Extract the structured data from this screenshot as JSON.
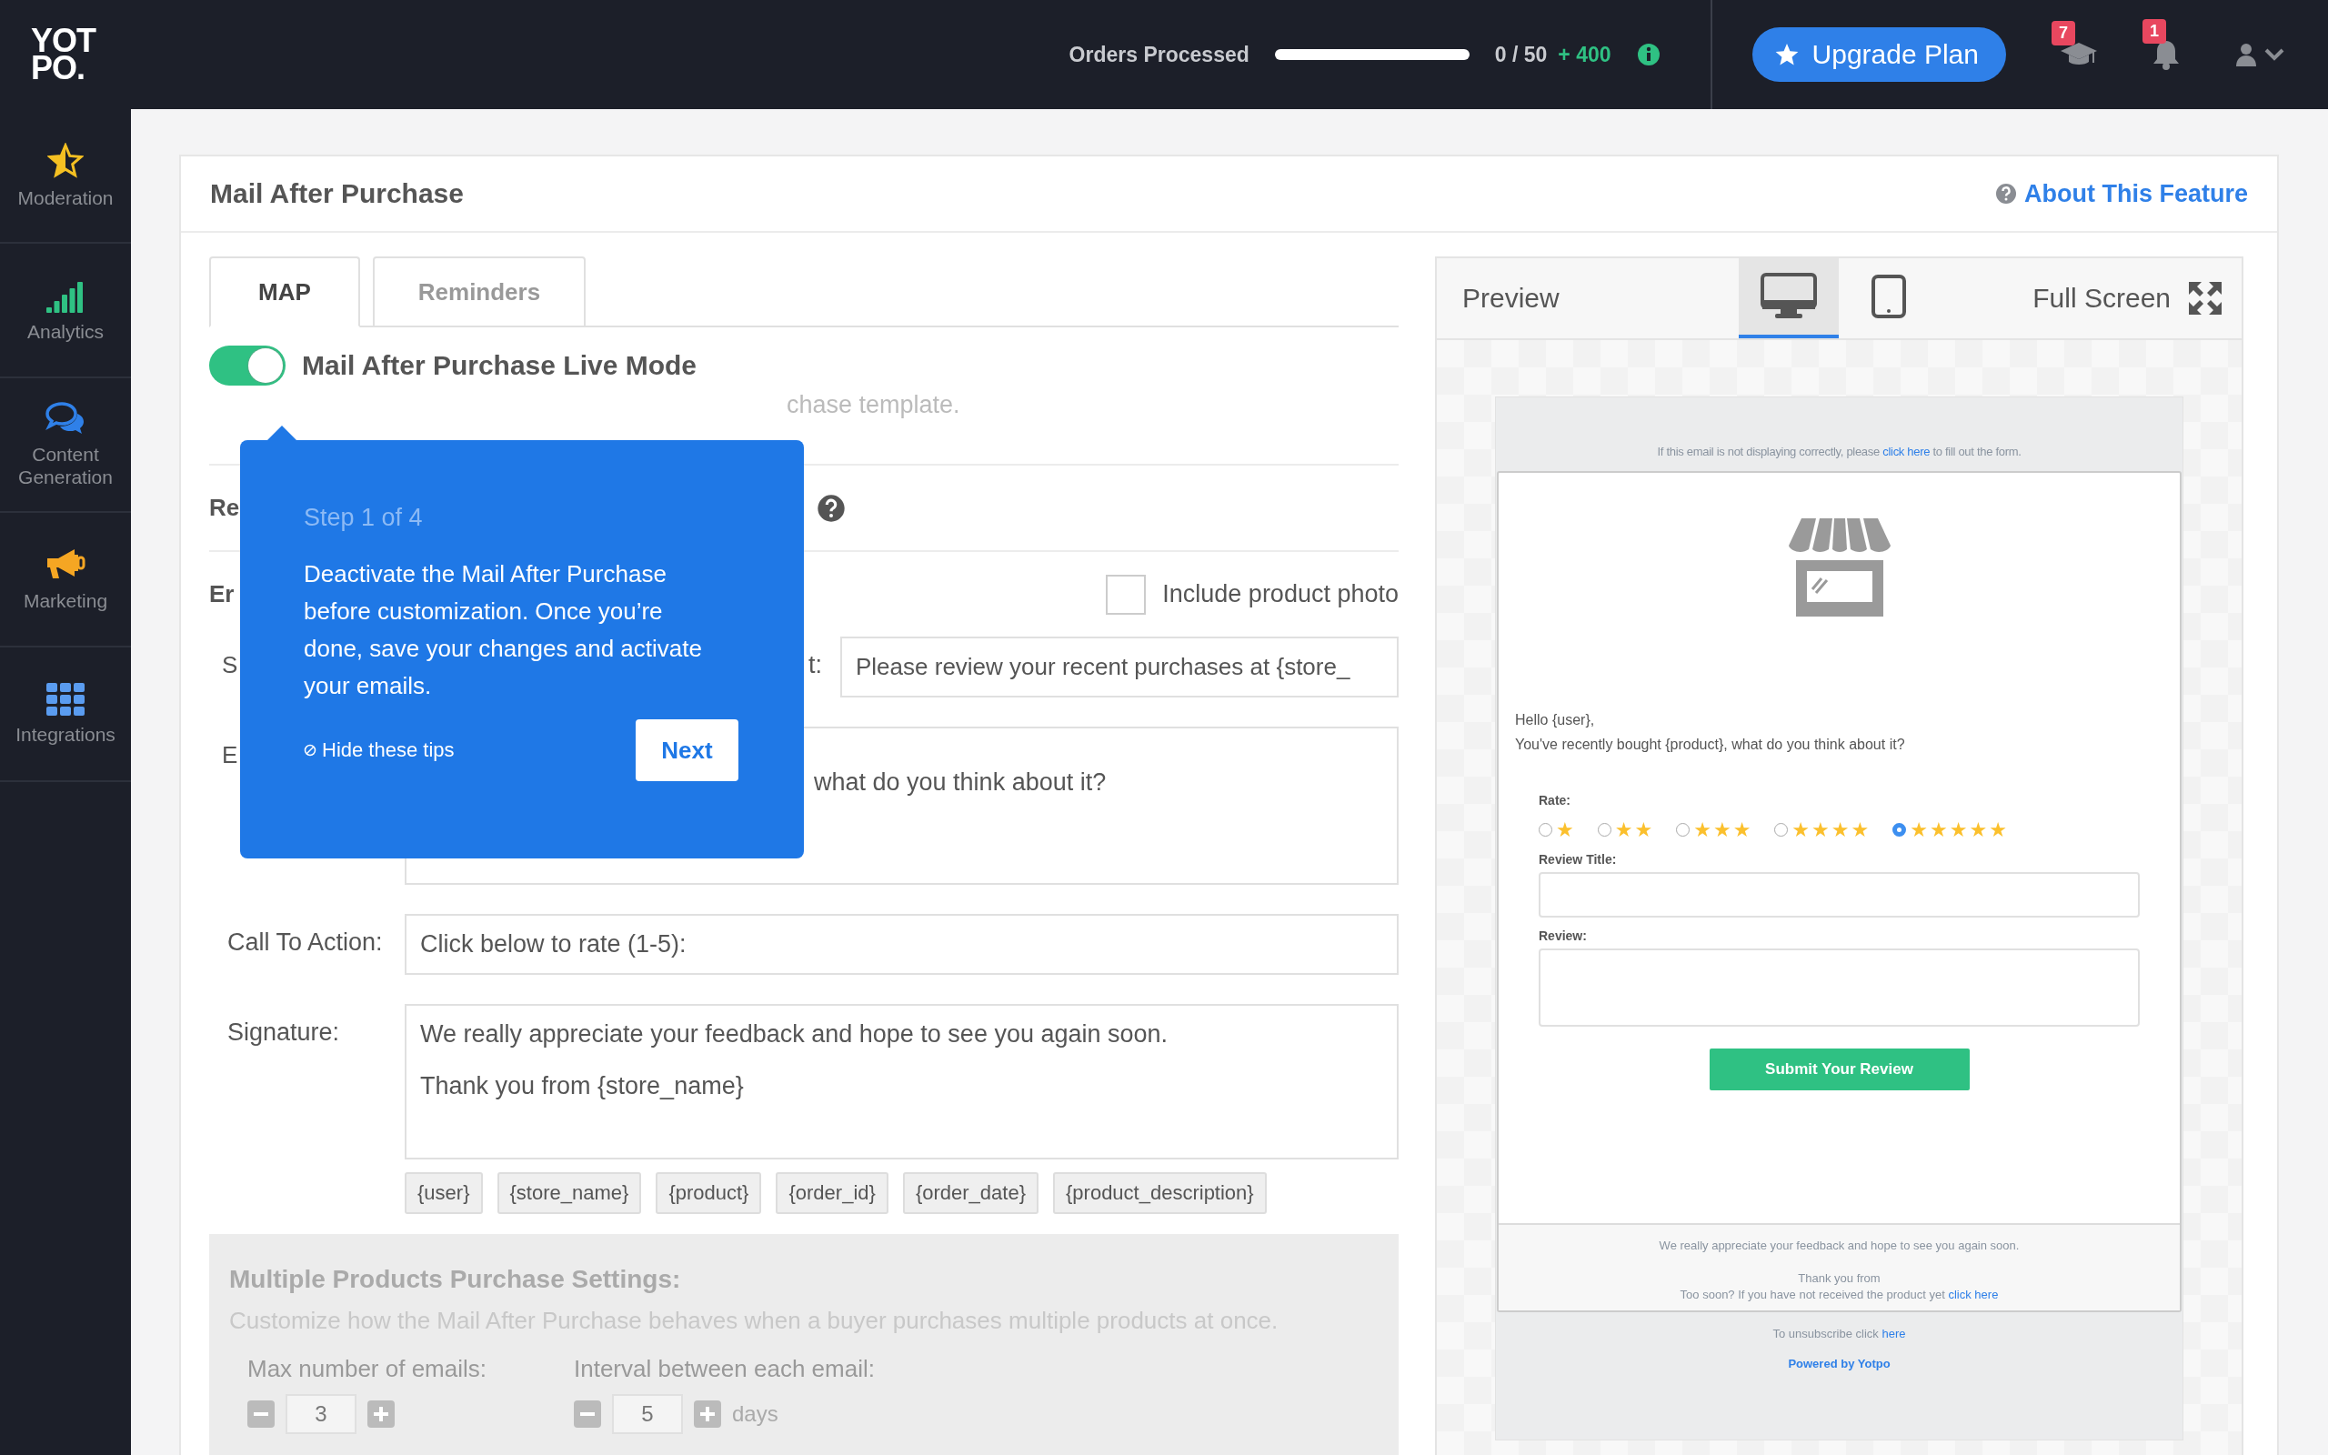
{
  "topbar": {
    "logo": [
      "YOT",
      "PO."
    ],
    "orders_label": "Orders Processed",
    "orders_progress": {
      "level": 0
    },
    "orders_count": "0 / 50",
    "orders_bonus": "+ 400",
    "upgrade_button": "Upgrade Plan",
    "notifications": [
      {
        "kind": "learn",
        "badge": "7"
      },
      {
        "kind": "bell",
        "badge": "1"
      }
    ]
  },
  "sidebar": [
    {
      "kind": "star",
      "label": "Moderation"
    },
    {
      "kind": "bars",
      "label": "Analytics"
    },
    {
      "kind": "chat",
      "label": "Content Generation"
    },
    {
      "kind": "megaphone",
      "label": "Marketing"
    },
    {
      "kind": "grid",
      "label": "Integrations"
    }
  ],
  "page": {
    "title": "Mail After Purchase",
    "about_link": "About This Feature"
  },
  "tabs": [
    {
      "label": "MAP",
      "selected": true
    },
    {
      "label": "Reminders",
      "selected": false
    }
  ],
  "live_mode": {
    "label": "Mail After Purchase Live Mode",
    "on": true,
    "hint_visible": "chase template."
  },
  "form": {
    "reminder_label_visible": "Re",
    "email_label_visible": "Er",
    "include_photo": {
      "label": "Include product photo",
      "checked": false
    },
    "subject": {
      "label_visible_start": "S",
      "label_visible_end": "t:",
      "value": "Please review your recent purchases at {store_"
    },
    "body": {
      "label_visible": "E",
      "value_visible": "what do you think about it?"
    },
    "call_to_action": {
      "label": "Call To Action:",
      "value": "Click below to rate (1-5):"
    },
    "signature": {
      "label": "Signature:",
      "lines": [
        "We really appreciate your feedback and hope to see you again soon.",
        "Thank you from {store_name}"
      ]
    },
    "tags": [
      "{user}",
      "{store_name}",
      "{product}",
      "{order_id}",
      "{order_date}",
      "{product_description}"
    ]
  },
  "multiple_products": {
    "disabled": true,
    "title": "Multiple Products Purchase Settings:",
    "description": "Customize how the Mail After Purchase behaves when a buyer purchases multiple products at once.",
    "max_emails": {
      "label": "Max number of emails:",
      "value": "3"
    },
    "interval": {
      "label": "Interval between each email:",
      "value": "5",
      "unit": "days"
    }
  },
  "tooltip": {
    "step": "Step 1 of 4",
    "text": "Deactivate the Mail After Purchase before customization. Once you’re done, save your changes and activate your emails.",
    "hide": "Hide these tips",
    "next": "Next"
  },
  "preview": {
    "title": "Preview",
    "devices": [
      {
        "kind": "desktop",
        "selected": true
      },
      {
        "kind": "tablet",
        "selected": false
      }
    ],
    "full_screen": "Full Screen",
    "email": {
      "notice": [
        "If this email is not displaying correctly, please",
        "click here",
        "to fill out the form."
      ],
      "greeting": [
        "Hello {user},",
        "You've recently bought {product}, what do you think about it?"
      ],
      "rate_label": "Rate:",
      "rating_options": [
        {
          "label": "★",
          "selected": false
        },
        {
          "label": "★★",
          "selected": false
        },
        {
          "label": "★★★",
          "selected": false
        },
        {
          "label": "★★★★",
          "selected": false
        },
        {
          "label": "★★★★★",
          "selected": true
        }
      ],
      "review_title_label": "Review Title:",
      "review_label": "Review:",
      "submit": "Submit Your Review",
      "footer": [
        "We really appreciate your feedback and hope to see you again soon.",
        "Thank you from"
      ],
      "too_soon": [
        "Too soon? If you have not received the product yet",
        "click here"
      ],
      "unsubscribe": [
        "To unsubscribe click",
        "here"
      ],
      "powered": "Powered by Yotpo"
    }
  }
}
